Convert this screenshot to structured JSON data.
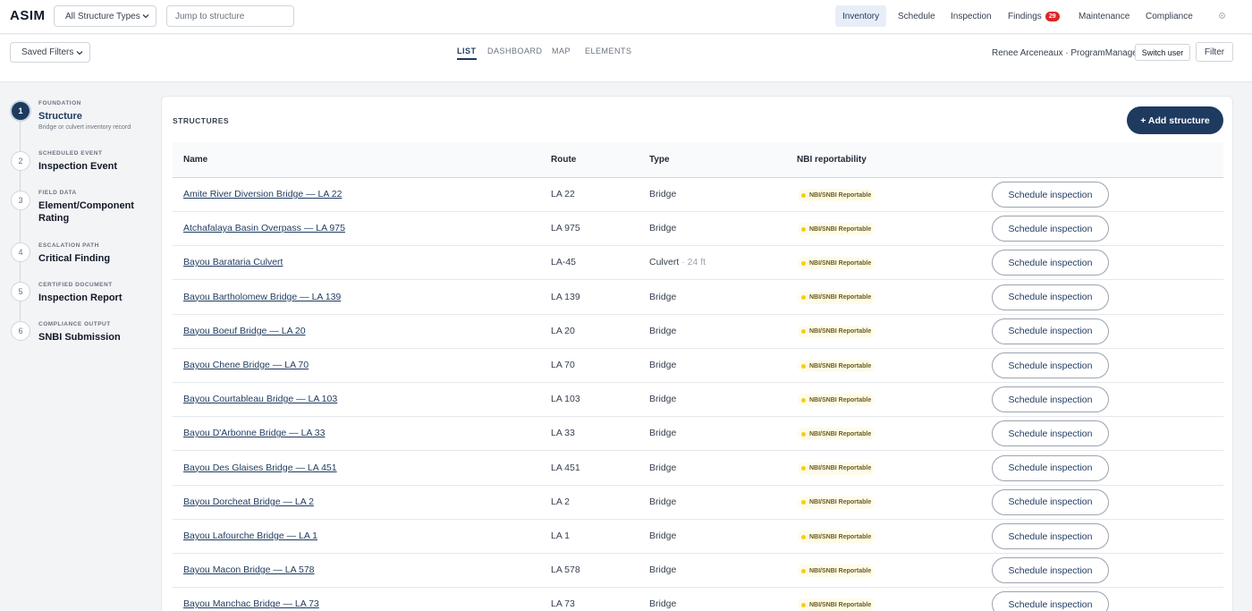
{
  "app": {
    "logo": "ASIM"
  },
  "topbar": {
    "structure_type_select": "All Structure Types",
    "jump_placeholder": "Jump to structure",
    "nav": [
      {
        "label": "Inventory",
        "active": true
      },
      {
        "label": "Schedule"
      },
      {
        "label": "Inspection"
      },
      {
        "label": "Findings",
        "badge": "29"
      },
      {
        "label": "Maintenance"
      },
      {
        "label": "Compliance"
      }
    ],
    "settings_icon": "gear-icon"
  },
  "subbar": {
    "saved_filters": "Saved Filters",
    "views": [
      "LIST",
      "DASHBOARD",
      "MAP",
      "ELEMENTS"
    ],
    "active_view": "LIST",
    "user_label": "Renee Arceneaux · ProgramManager",
    "switch_user": "Switch user",
    "filter": "Filter"
  },
  "steps": [
    {
      "num": "1",
      "eyebrow": "FOUNDATION",
      "title": "Structure",
      "sub": "Bridge or culvert inventory record",
      "active": true
    },
    {
      "num": "2",
      "eyebrow": "SCHEDULED EVENT",
      "title": "Inspection Event"
    },
    {
      "num": "3",
      "eyebrow": "FIELD DATA",
      "title": "Element/Component Rating"
    },
    {
      "num": "4",
      "eyebrow": "ESCALATION PATH",
      "title": "Critical Finding"
    },
    {
      "num": "5",
      "eyebrow": "CERTIFIED DOCUMENT",
      "title": "Inspection Report"
    },
    {
      "num": "6",
      "eyebrow": "COMPLIANCE OUTPUT",
      "title": "SNBI Submission"
    }
  ],
  "structures": {
    "title": "STRUCTURES",
    "add_button": "+ Add structure",
    "columns": [
      "Name",
      "Route",
      "Type",
      "NBI reportability"
    ],
    "action_label": "Schedule inspection",
    "rows": [
      {
        "name": "Amite River Diversion Bridge — LA 22",
        "route": "LA 22",
        "type": "Bridge",
        "type_extra": "",
        "nbi": "NBI/SNBI Reportable"
      },
      {
        "name": "Atchafalaya Basin Overpass — LA 975",
        "route": "LA 975",
        "type": "Bridge",
        "type_extra": "",
        "nbi": "NBI/SNBI Reportable"
      },
      {
        "name": "Bayou Barataria Culvert",
        "route": "LA-45",
        "type": "Culvert",
        "type_extra": "· 24 ft",
        "nbi": "NBI/SNBI Reportable"
      },
      {
        "name": "Bayou Bartholomew Bridge — LA 139",
        "route": "LA 139",
        "type": "Bridge",
        "type_extra": "",
        "nbi": "NBI/SNBI Reportable"
      },
      {
        "name": "Bayou Boeuf Bridge — LA 20",
        "route": "LA 20",
        "type": "Bridge",
        "type_extra": "",
        "nbi": "NBI/SNBI Reportable"
      },
      {
        "name": "Bayou Chene Bridge — LA 70",
        "route": "LA 70",
        "type": "Bridge",
        "type_extra": "",
        "nbi": "NBI/SNBI Reportable"
      },
      {
        "name": "Bayou Courtableau Bridge — LA 103",
        "route": "LA 103",
        "type": "Bridge",
        "type_extra": "",
        "nbi": "NBI/SNBI Reportable"
      },
      {
        "name": "Bayou D'Arbonne Bridge — LA 33",
        "route": "LA 33",
        "type": "Bridge",
        "type_extra": "",
        "nbi": "NBI/SNBI Reportable"
      },
      {
        "name": "Bayou Des Glaises Bridge — LA 451",
        "route": "LA 451",
        "type": "Bridge",
        "type_extra": "",
        "nbi": "NBI/SNBI Reportable"
      },
      {
        "name": "Bayou Dorcheat Bridge — LA 2",
        "route": "LA 2",
        "type": "Bridge",
        "type_extra": "",
        "nbi": "NBI/SNBI Reportable"
      },
      {
        "name": "Bayou Lafourche Bridge — LA 1",
        "route": "LA 1",
        "type": "Bridge",
        "type_extra": "",
        "nbi": "NBI/SNBI Reportable"
      },
      {
        "name": "Bayou Macon Bridge — LA 578",
        "route": "LA 578",
        "type": "Bridge",
        "type_extra": "",
        "nbi": "NBI/SNBI Reportable"
      },
      {
        "name": "Bayou Manchac Bridge — LA 73",
        "route": "LA 73",
        "type": "Bridge",
        "type_extra": "",
        "nbi": "NBI/SNBI Reportable"
      }
    ]
  }
}
